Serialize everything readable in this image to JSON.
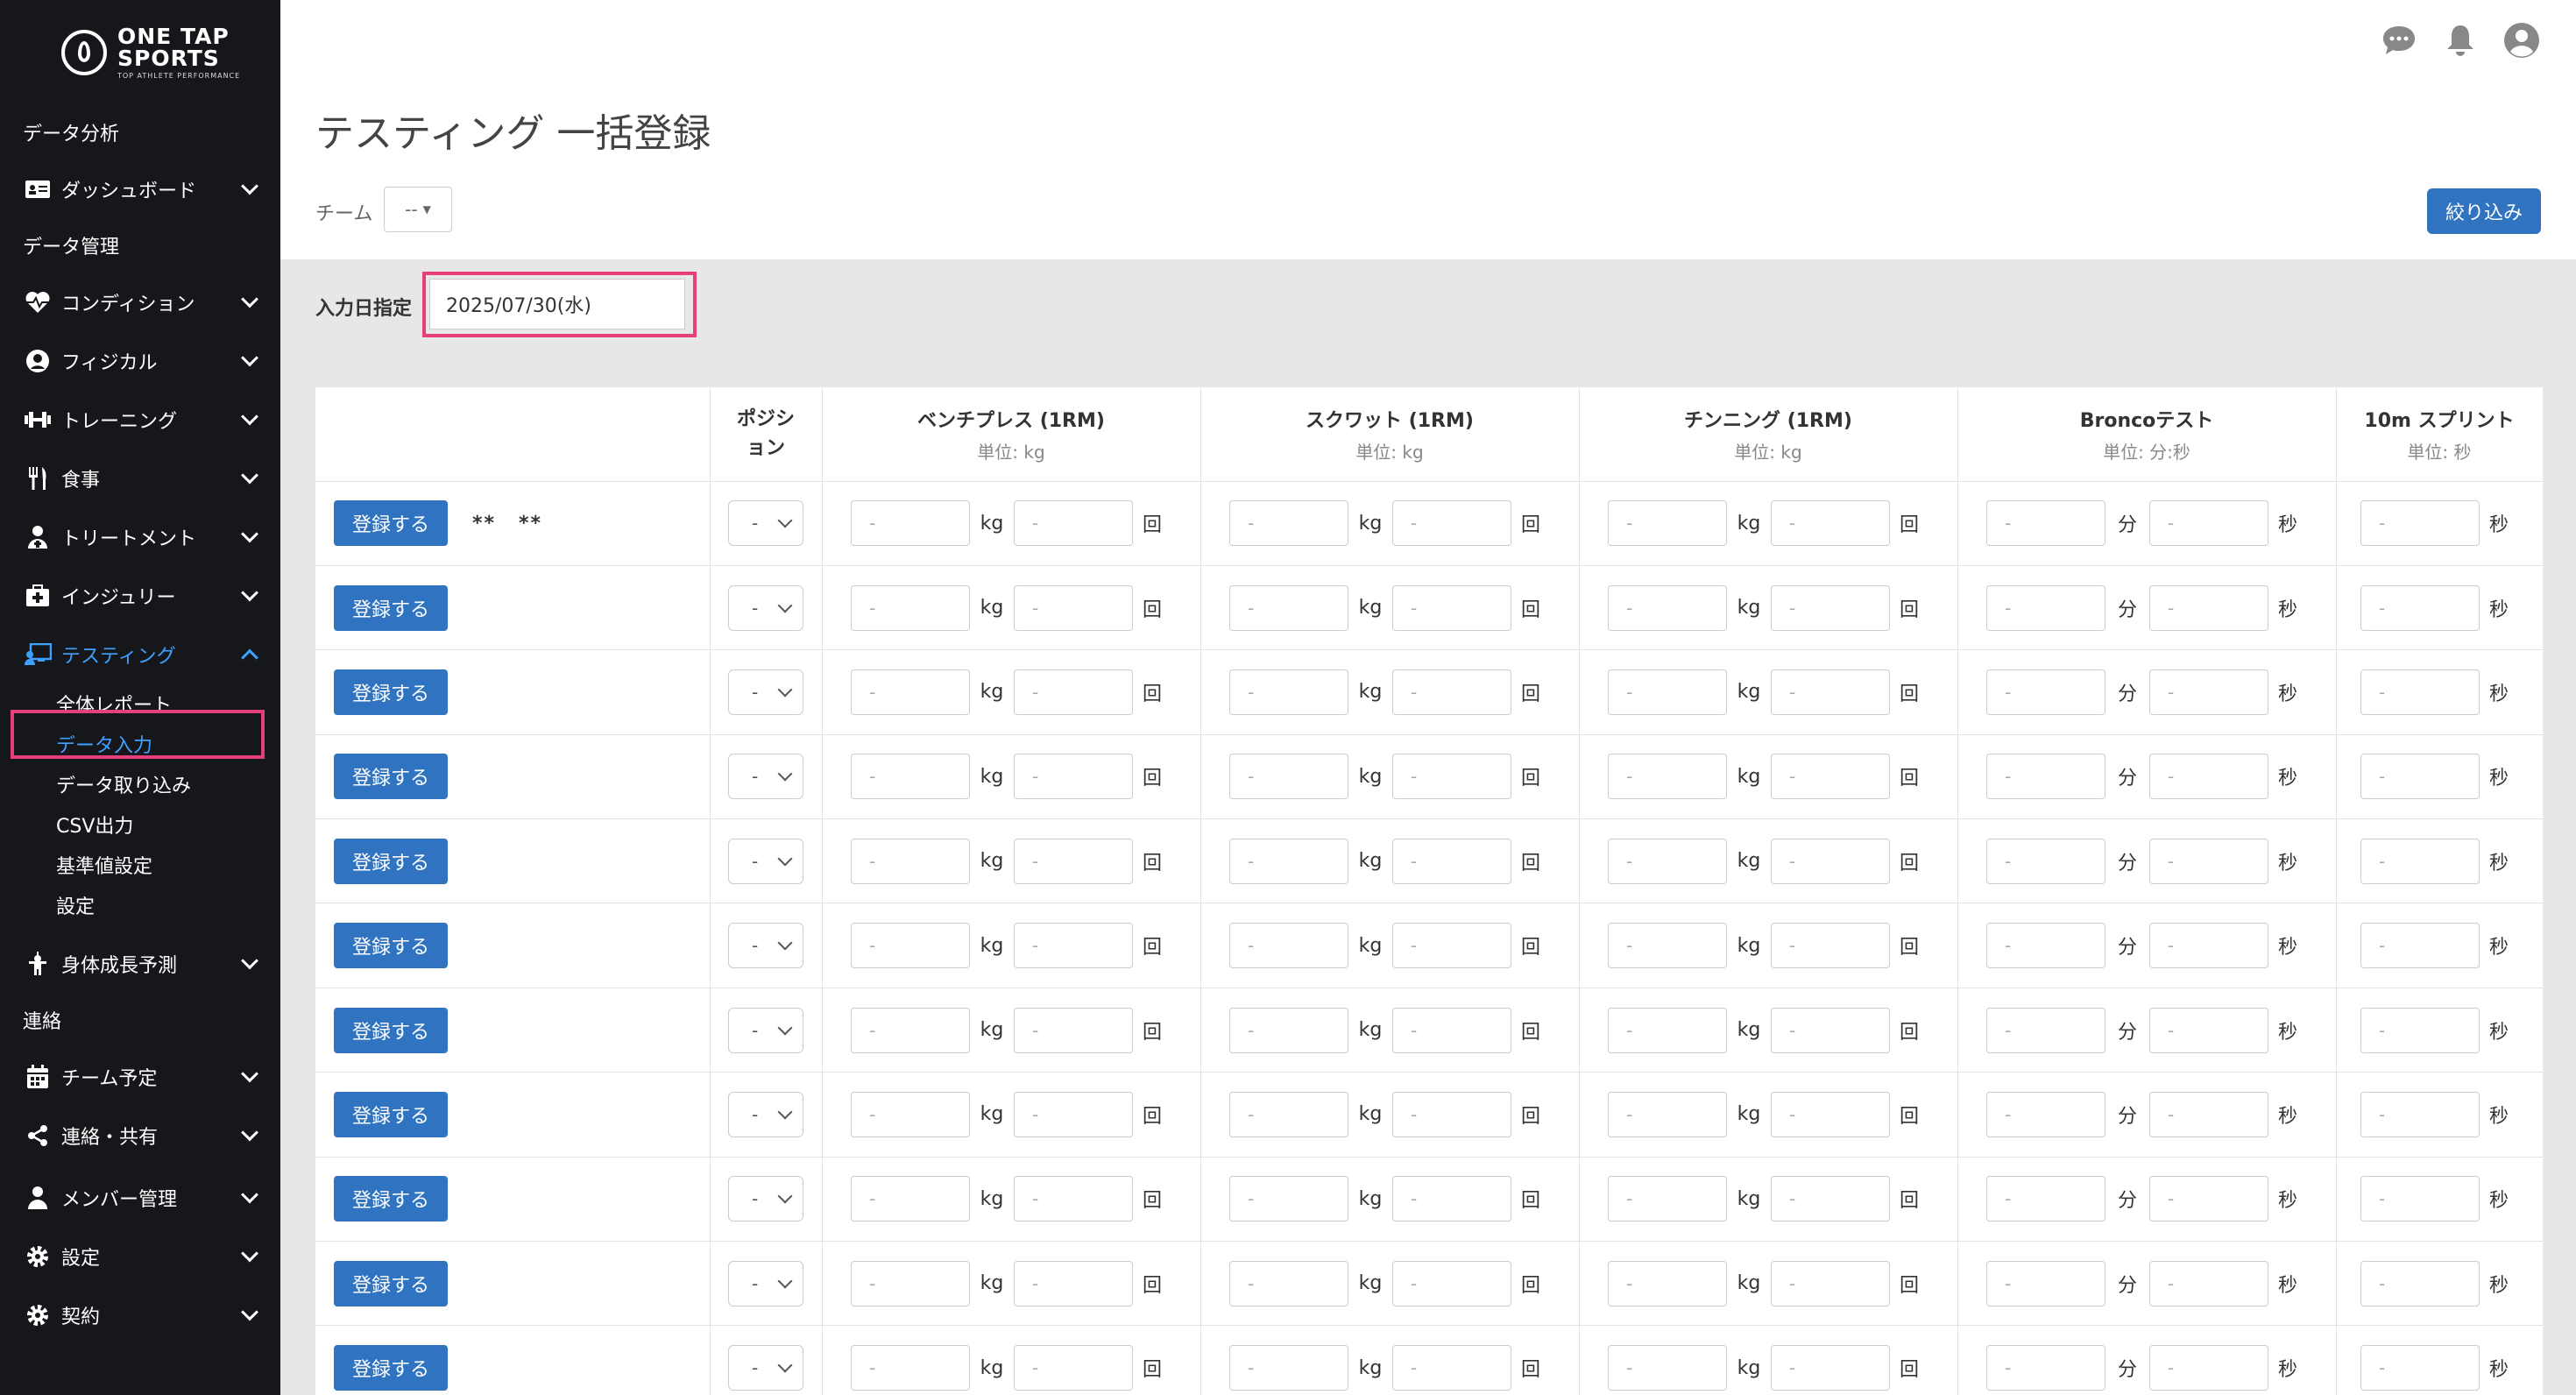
{
  "sidebar": {
    "logo_line1": "ONE TAP",
    "logo_line2": "SPORTS",
    "logo_sub": "TOP ATHLETE PERFORMANCE",
    "sections": [
      {
        "label": "データ分析"
      },
      {
        "label": "データ管理"
      },
      {
        "label": "連絡"
      }
    ],
    "items": [
      {
        "label": "ダッシュボード",
        "icon": "id-card-icon"
      },
      {
        "label": "コンディション",
        "icon": "heart-pulse-icon"
      },
      {
        "label": "フィジカル",
        "icon": "user-circle-icon"
      },
      {
        "label": "トレーニング",
        "icon": "dumbbell-icon"
      },
      {
        "label": "食事",
        "icon": "utensils-icon"
      },
      {
        "label": "トリートメント",
        "icon": "user-medical-icon"
      },
      {
        "label": "インジュリー",
        "icon": "first-aid-kit-icon"
      },
      {
        "label": "テスティング",
        "icon": "chalkboard-teacher-icon"
      },
      {
        "label": "身体成長予測",
        "icon": "child-growth-icon"
      },
      {
        "label": "チーム予定",
        "icon": "calendar-icon"
      },
      {
        "label": "連絡・共有",
        "icon": "share-icon"
      },
      {
        "label": "メンバー管理",
        "icon": "user-icon"
      },
      {
        "label": "設定",
        "icon": "gear-icon"
      },
      {
        "label": "契約",
        "icon": "gear-icon"
      }
    ],
    "testing_sub": [
      {
        "label": "全体レポート"
      },
      {
        "label": "データ入力"
      },
      {
        "label": "データ取り込み"
      },
      {
        "label": "CSV出力"
      },
      {
        "label": "基準値設定"
      },
      {
        "label": "設定"
      }
    ]
  },
  "header": {
    "icons": [
      "chat-icon",
      "bell-icon",
      "user-avatar-icon"
    ]
  },
  "page": {
    "title": "テスティング 一括登録",
    "team_label": "チーム",
    "team_value": "--",
    "filter_button": "絞り込み",
    "date_label": "入力日指定",
    "date_value": "2025/07/30(水)"
  },
  "table": {
    "columns": {
      "position": "ポジション",
      "bench": {
        "name": "ベンチプレス (1RM)",
        "unit": "単位: kg",
        "u1": "kg",
        "u2": "回"
      },
      "squat": {
        "name": "スクワット (1RM)",
        "unit": "単位: kg",
        "u1": "kg",
        "u2": "回"
      },
      "chinning": {
        "name": "チンニング (1RM)",
        "unit": "単位: kg",
        "u1": "kg",
        "u2": "回"
      },
      "bronco": {
        "name": "Broncoテスト",
        "unit": "単位: 分:秒",
        "u1": "分",
        "u2": "秒"
      },
      "sprint": {
        "name": "10m スプリント",
        "unit": "単位: 秒",
        "u1": "秒"
      }
    },
    "register_label": "登録する",
    "placeholder": "-",
    "position_value": "-",
    "first_row_name_1": "**",
    "first_row_name_2": "**",
    "row_count": 11
  }
}
